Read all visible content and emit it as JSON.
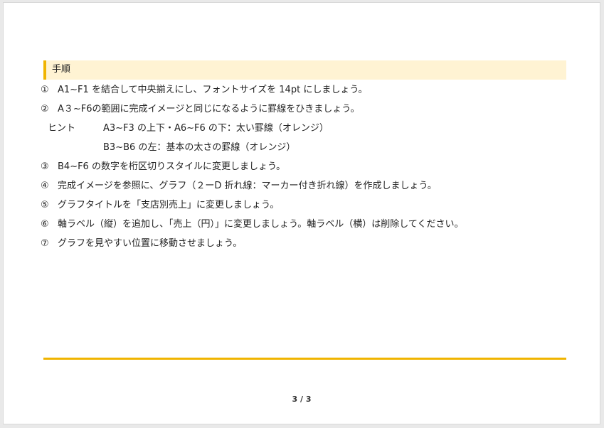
{
  "section": {
    "title": "手順"
  },
  "steps": [
    {
      "num": "①",
      "text": "A1~F1 を結合して中央揃えにし、フォントサイズを 14pt にしましょう。"
    },
    {
      "num": "②",
      "text": "A３~F6の範囲に完成イメージと同じになるように罫線をひきましょう。"
    },
    {
      "hint_label": "ヒント",
      "text": "A3~F3 の上下・A6~F6 の下：太い罫線（オレンジ）"
    },
    {
      "hint_label": "",
      "text": "B3~B6 の左：基本の太さの罫線（オレンジ）"
    },
    {
      "num": "③",
      "text": "B4~F6 の数字を桁区切りスタイルに変更しましょう。"
    },
    {
      "num": "④",
      "text": "完成イメージを参照に、グラフ（２ーD 折れ線：マーカー付き折れ線）を作成しましょう。"
    },
    {
      "num": "⑤",
      "text": "グラフタイトルを「支店別売上」に変更しましょう。"
    },
    {
      "num": "⑥",
      "text": "軸ラベル（縦）を追加し、「売上（円）」に変更しましょう。軸ラベル（横）は削除してください。"
    },
    {
      "num": "⑦",
      "text": "グラフを見やすい位置に移動させましょう。"
    }
  ],
  "footer": {
    "page_number": "3 / 3"
  },
  "colors": {
    "accent": "#f0b400",
    "header_bg": "#fff3d3"
  }
}
